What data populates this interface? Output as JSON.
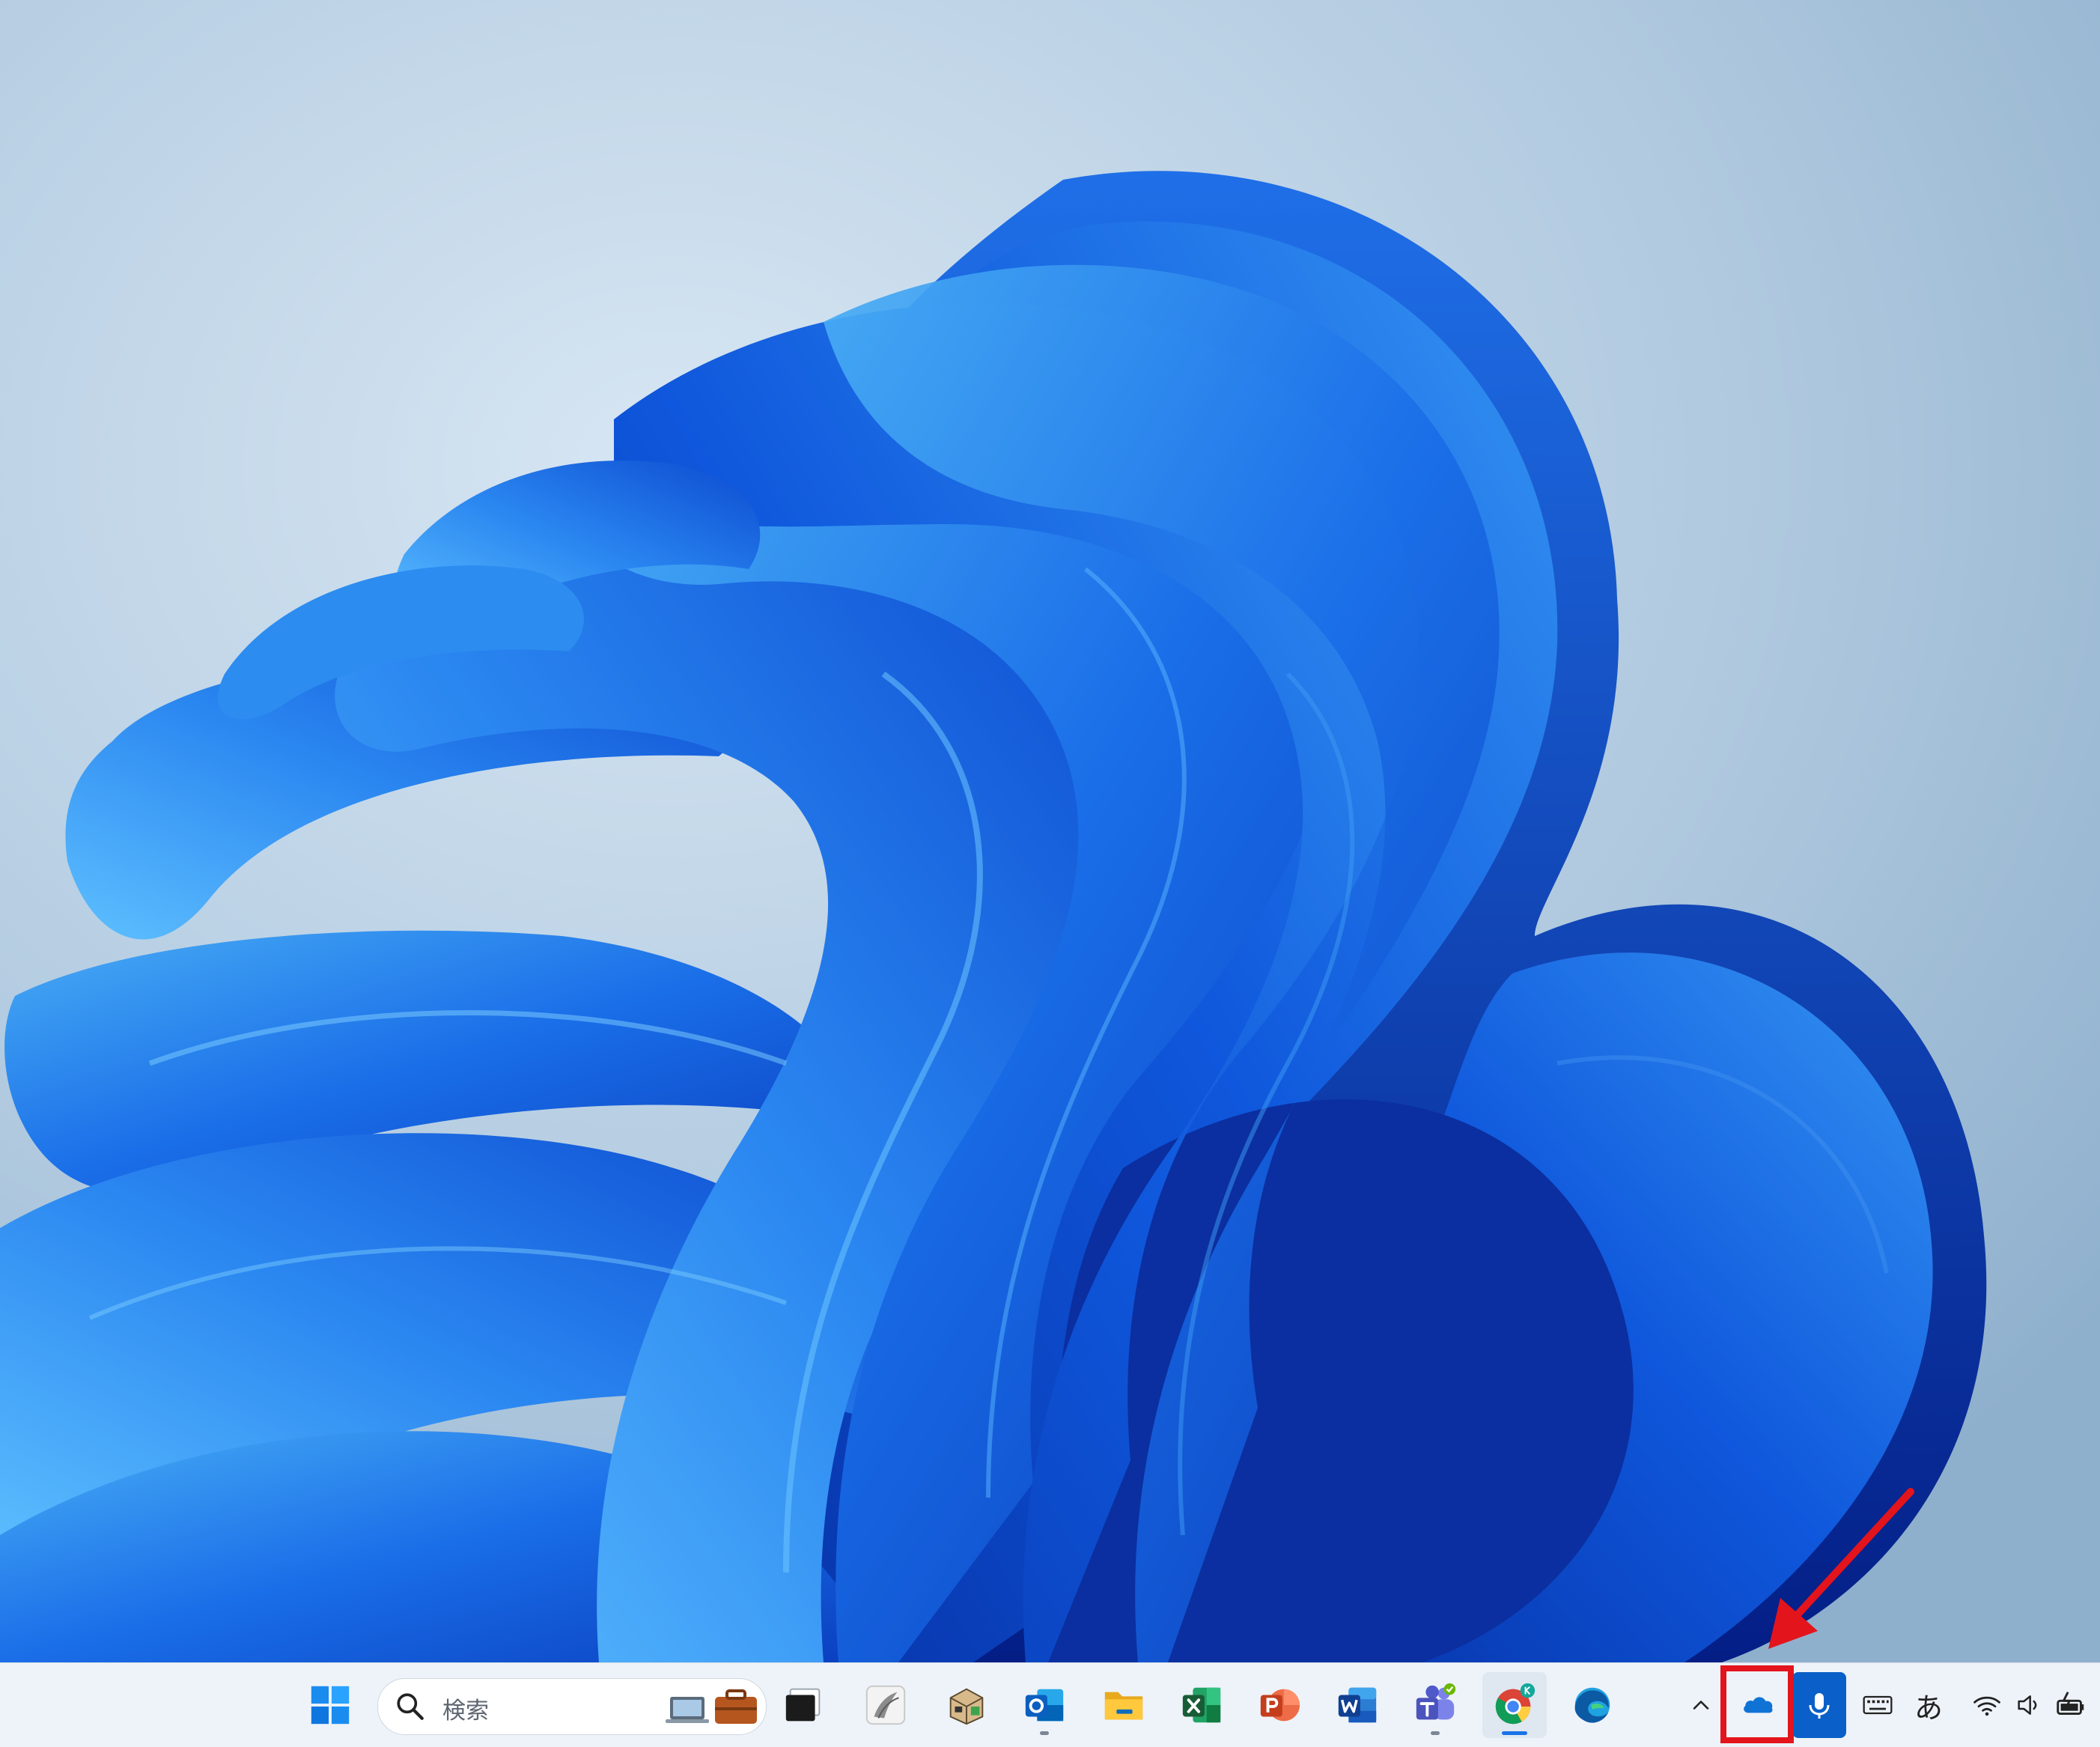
{
  "taskbar": {
    "search": {
      "placeholder": "検索"
    },
    "ime_mode": "あ",
    "active_app": "google-chrome"
  },
  "colors": {
    "taskbar_bg": "#eef3f9",
    "highlight": "#e3141c",
    "onedrive_blue": "#0f73d6",
    "voice_blue": "#0a60c8"
  },
  "icons": [
    "windows-start-icon",
    "search-icon",
    "task-view-icon",
    "app-icon",
    "package-app-icon",
    "outlook-icon",
    "file-explorer-icon",
    "excel-icon",
    "powerpoint-icon",
    "word-icon",
    "teams-icon",
    "chrome-icon",
    "edge-icon",
    "chevron-up-icon",
    "onedrive-cloud-icon",
    "microphone-icon",
    "keyboard-icon",
    "wifi-icon",
    "speaker-icon",
    "battery-icon"
  ]
}
